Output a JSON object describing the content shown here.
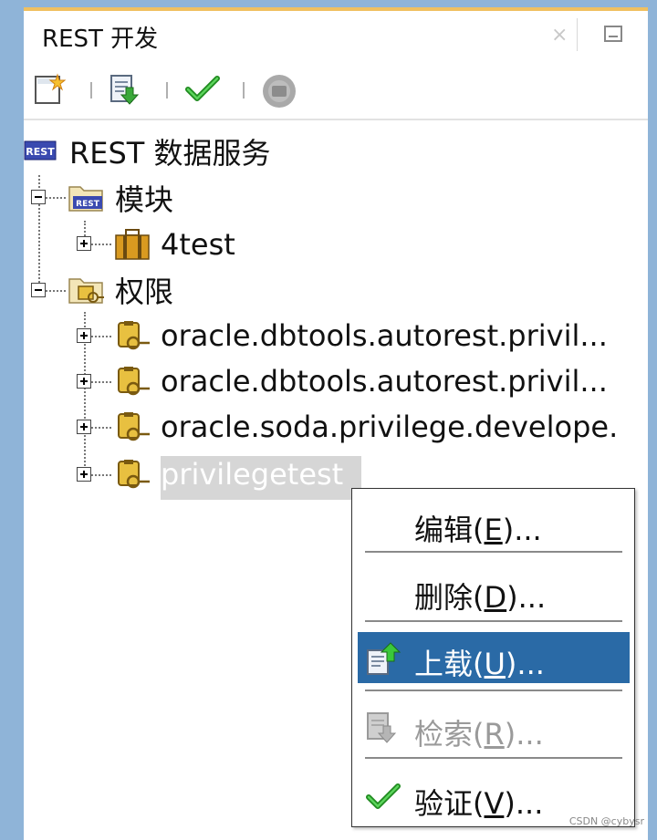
{
  "panel": {
    "tab_title": "REST 开发",
    "close_glyph": "×"
  },
  "toolbar": {
    "buttons": [
      {
        "name": "new-button",
        "icon": "new-document-icon"
      },
      {
        "name": "download-button",
        "icon": "download-icon"
      },
      {
        "name": "validate-button",
        "icon": "checkmark-icon"
      },
      {
        "name": "connect-button",
        "icon": "connection-icon",
        "disabled": true
      }
    ]
  },
  "tree": {
    "root": "REST 数据服务",
    "modules": "模块",
    "module_items": [
      "4test"
    ],
    "privileges": "权限",
    "privilege_items": [
      "oracle.dbtools.autorest.privil...",
      "oracle.dbtools.autorest.privil...",
      "oracle.soda.privilege.develope.",
      "privilegetest"
    ]
  },
  "context_menu": {
    "items": [
      {
        "pre": "编辑(",
        "key": "E",
        "post": ")...",
        "state": "normal"
      },
      {
        "pre": "删除(",
        "key": "D",
        "post": ")...",
        "state": "normal"
      },
      {
        "pre": "上载(",
        "key": "U",
        "post": ")...",
        "state": "active"
      },
      {
        "pre": "检索(",
        "key": "R",
        "post": ")...",
        "state": "disabled"
      },
      {
        "pre": "验证(",
        "key": "V",
        "post": ")...",
        "state": "normal"
      }
    ]
  },
  "watermark": "CSDN @cybysr",
  "colors": {
    "background": "#8fb4d8",
    "tab_accent": "#f0c060",
    "menu_highlight": "#2a6aa6",
    "selection": "#d6d6d6"
  }
}
